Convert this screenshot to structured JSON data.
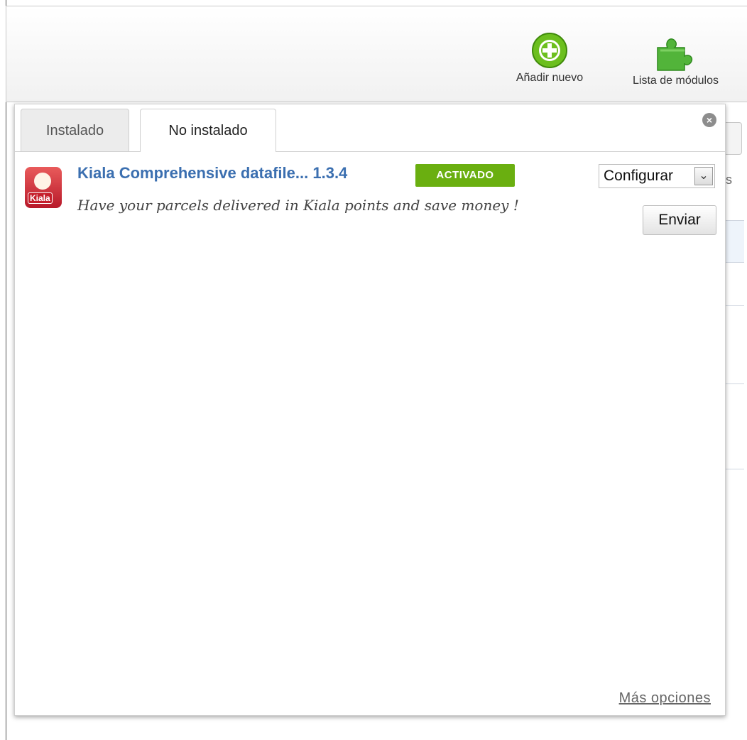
{
  "toolbar": {
    "add_new_label": "Añadir nuevo",
    "module_list_label": "Lista de módulos"
  },
  "tabs": [
    {
      "label": "Instalado",
      "active": false
    },
    {
      "label": "No instalado",
      "active": true
    }
  ],
  "close_label": "×",
  "module": {
    "name": "Kiala Comprehensive datafile...",
    "version": "1.3.4",
    "status": "ACTIVADO",
    "description": "Have your parcels delivered in Kiala points and save money !",
    "logo_text": "Kiala",
    "action_selected": "Configurar",
    "send_label": "Enviar"
  },
  "more_options_label": "Más opciones",
  "background": {
    "truncated_header_char": "s"
  },
  "colors": {
    "accent_blue": "#3b6fb0",
    "badge_green": "#6aaf10",
    "add_icon_green": "#6cbf1e",
    "puzzle_green": "#52b43a"
  },
  "icons": [
    "add-icon",
    "puzzle-icon",
    "close-icon",
    "kiala-logo-icon",
    "dropdown-arrow-icon"
  ]
}
